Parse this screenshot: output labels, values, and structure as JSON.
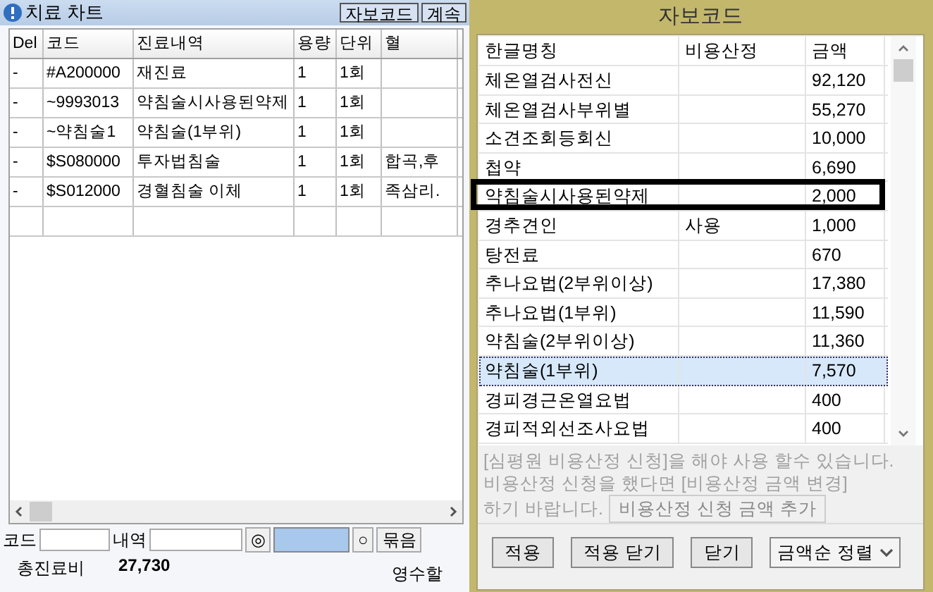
{
  "chart": {
    "title": "치료 차트",
    "buttons": [
      "자보코드",
      "계속"
    ],
    "columns": [
      "Del",
      "코드",
      "진료내역",
      "용량",
      "단위",
      "혈"
    ],
    "rows": [
      [
        "-",
        "#A200000",
        "재진료",
        "1",
        "1회"
      ],
      [
        "-",
        "~9993013",
        "약침술시사용된약제",
        "1",
        "1회"
      ],
      [
        "-",
        "~약침술1",
        "약침술(1부위)",
        "1",
        "1회"
      ],
      [
        "-",
        "$S080000",
        "투자법침술",
        "1",
        "1회",
        "합곡,후"
      ],
      [
        "-",
        "$S012000",
        "경혈침술 이체",
        "1",
        "1회",
        "족삼리."
      ]
    ],
    "toolbar": {
      "code_label": "코드",
      "desc_label": "내역",
      "double_circle": "◎",
      "circle": "○",
      "group_button": "묶음"
    },
    "summary": {
      "total_label": "총진료비",
      "total": "27,730",
      "receipt_label": "영수할"
    }
  },
  "dialog": {
    "title": "자보코드",
    "columns": [
      "한글명칭",
      "비용산정",
      "금액"
    ],
    "rows": [
      {
        "name": "체온열검사전신",
        "amount": "92,120",
        "selected": false,
        "boxed": false
      },
      {
        "name": "체온열검사부위별",
        "amount": "55,270",
        "selected": false,
        "boxed": false
      },
      {
        "name": "소견조회등회신",
        "amount": "10,000",
        "selected": false,
        "boxed": false
      },
      {
        "name": "첩약",
        "amount": "6,690",
        "selected": false,
        "boxed": false
      },
      {
        "name": "약침술시사용된약제",
        "amount": "2,000",
        "selected": false,
        "boxed": true
      },
      {
        "name": "경추견인",
        "cost": "사용",
        "amount": "1,000",
        "selected": false,
        "boxed": false
      },
      {
        "name": "탕전료",
        "amount": "670",
        "selected": false,
        "boxed": false
      },
      {
        "name": "추나요법(2부위이상)",
        "amount": "17,380",
        "selected": false,
        "boxed": false
      },
      {
        "name": "추나요법(1부위)",
        "amount": "11,590",
        "selected": false,
        "boxed": false
      },
      {
        "name": "약침술(2부위이상)",
        "amount": "11,360",
        "selected": false,
        "boxed": false
      },
      {
        "name": "약침술(1부위)",
        "amount": "7,570",
        "selected": true,
        "boxed": false
      },
      {
        "name": "경피경근온열요법",
        "amount": "400",
        "selected": false,
        "boxed": false
      },
      {
        "name": "경피적외선조사요법",
        "amount": "400",
        "selected": false,
        "boxed": false
      }
    ],
    "notice": [
      "[심평원 비용산정 신청]을 해야 사용 할수 있습니다.",
      "비용산정 신청을 했다면 [비용산정 금액 변경]",
      "하기 바랍니다."
    ],
    "add_button": "비용산정 신청 금액 추가",
    "buttons": [
      "적용",
      "적용 닫기",
      "닫기"
    ],
    "sort": "금액순 정렬"
  }
}
